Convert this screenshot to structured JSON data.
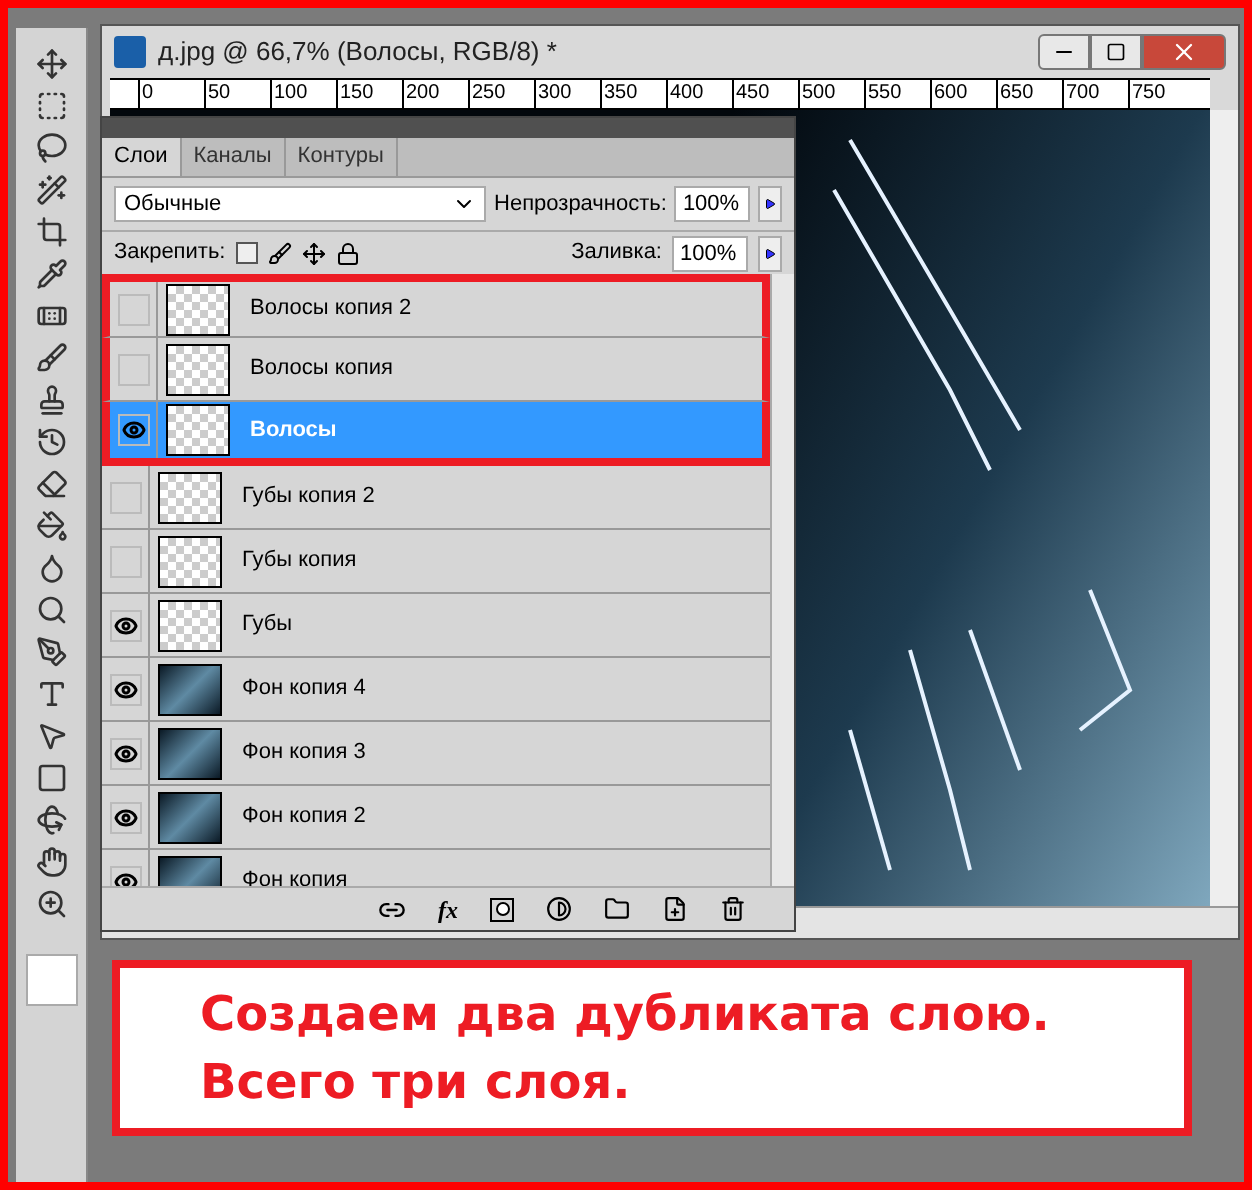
{
  "document": {
    "title": "д.jpg @ 66,7% (Волосы, RGB/8) *",
    "ruler": [
      "0",
      "50",
      "100",
      "150",
      "200",
      "250",
      "300",
      "350",
      "400",
      "450",
      "500",
      "550",
      "600",
      "650",
      "700",
      "750"
    ]
  },
  "layers_panel": {
    "tabs": [
      {
        "label": "Слои",
        "selected": true
      },
      {
        "label": "Каналы",
        "selected": false
      },
      {
        "label": "Контуры",
        "selected": false
      }
    ],
    "blend_mode": "Обычные",
    "opacity_label": "Непрозрачность:",
    "opacity": "100%",
    "lock_label": "Закрепить:",
    "fill_label": "Заливка:",
    "fill": "100%",
    "layers": [
      {
        "name": "Волосы копия 2",
        "visible": false,
        "selected": false,
        "highlighted": true,
        "kind": "transparent"
      },
      {
        "name": "Волосы копия",
        "visible": false,
        "selected": false,
        "highlighted": true,
        "kind": "transparent"
      },
      {
        "name": "Волосы",
        "visible": true,
        "selected": true,
        "highlighted": true,
        "kind": "transparent"
      },
      {
        "name": "Губы копия 2",
        "visible": false,
        "selected": false,
        "highlighted": false,
        "kind": "transparent"
      },
      {
        "name": "Губы копия",
        "visible": false,
        "selected": false,
        "highlighted": false,
        "kind": "transparent"
      },
      {
        "name": "Губы",
        "visible": true,
        "selected": false,
        "highlighted": false,
        "kind": "transparent"
      },
      {
        "name": "Фон копия 4",
        "visible": true,
        "selected": false,
        "highlighted": false,
        "kind": "photo"
      },
      {
        "name": "Фон копия 3",
        "visible": true,
        "selected": false,
        "highlighted": false,
        "kind": "photo"
      },
      {
        "name": "Фон копия 2",
        "visible": true,
        "selected": false,
        "highlighted": false,
        "kind": "photo"
      },
      {
        "name": "Фон копия",
        "visible": true,
        "selected": false,
        "highlighted": false,
        "kind": "photo"
      }
    ],
    "footer_fx": "fx"
  },
  "annotation": {
    "lines": [
      "Создаем два дубликата слою.",
      "Всего три слоя."
    ]
  }
}
